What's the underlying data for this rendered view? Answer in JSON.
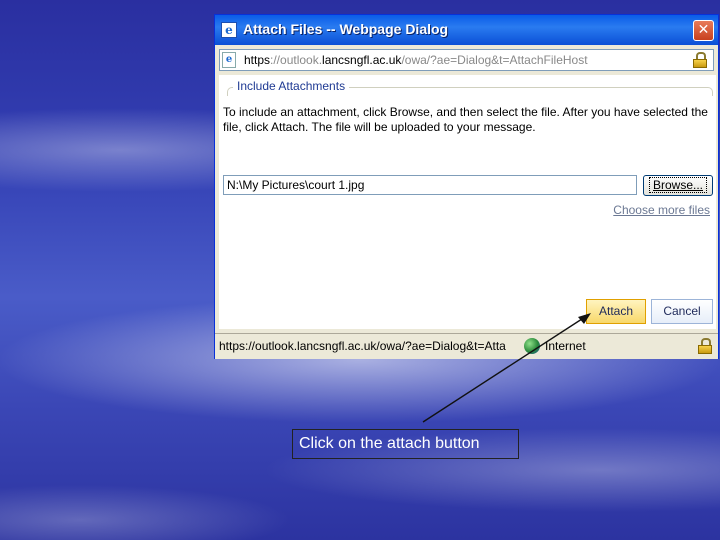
{
  "dialog": {
    "title": "Attach Files -- Webpage Dialog",
    "close_glyph": "✕",
    "address": {
      "prefix": "https",
      "pre": "://outlook.",
      "domain": "lancsngfl.ac.uk",
      "rest": "/owa/?ae=Dialog&t=AttachFileHost"
    },
    "legend": "Include Attachments",
    "instructions": "To include an attachment, click Browse, and then select the file. After you have selected the file, click Attach. The file will be uploaded to your message.",
    "file_path": "N:\\My Pictures\\court 1.jpg",
    "browse_label": "Browse...",
    "choose_more_label": "Choose more files",
    "attach_label": "Attach",
    "cancel_label": "Cancel",
    "status_url": "https://outlook.lancsngfl.ac.uk/owa/?ae=Dialog&t=Atta",
    "zone": "Internet",
    "icons": [
      "ie-page-icon",
      "lock-icon",
      "globe-icon",
      "close-icon"
    ]
  },
  "caption": "Click on the attach button"
}
